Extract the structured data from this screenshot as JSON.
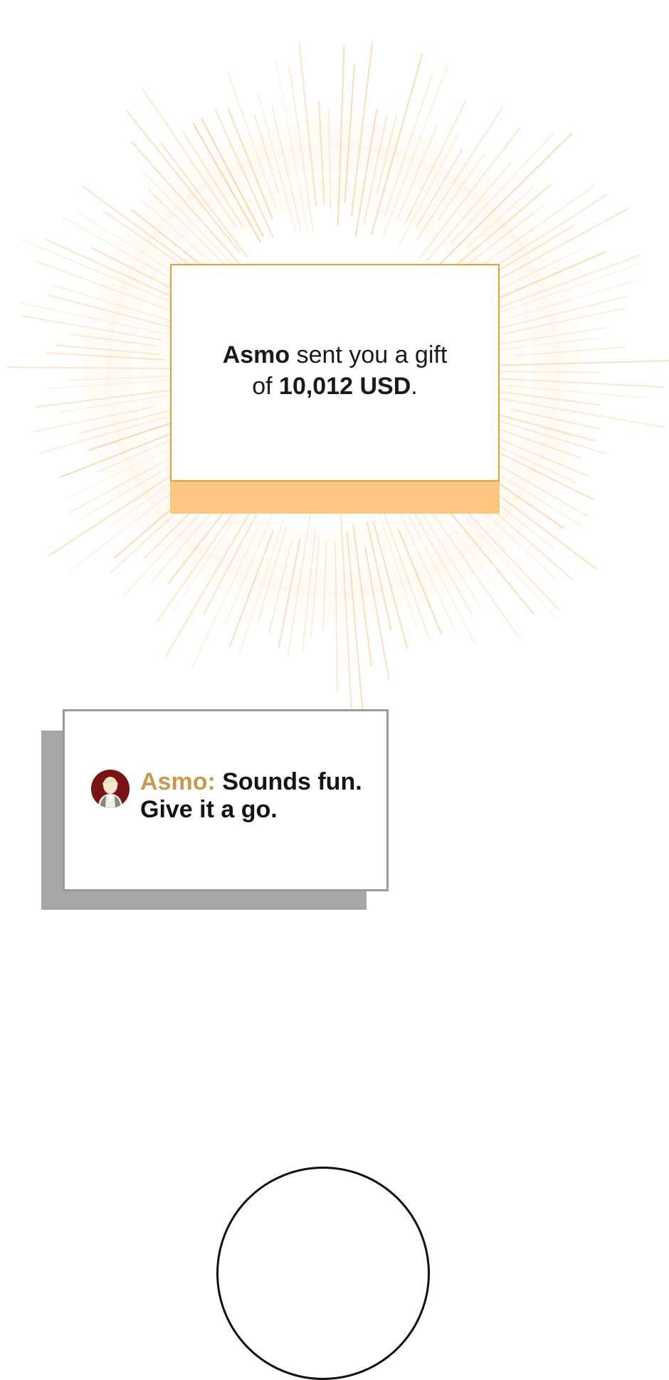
{
  "colors": {
    "gift_border": "#f29a33",
    "gift_tab": "#fcc580",
    "burst_ray": "#f6c27a",
    "speaker_name": "#c79a4e",
    "chat_border": "#9b9b9b",
    "chat_shadow": "#a6a6a6",
    "avatar_bg": "#7a1414"
  },
  "gift_notification": {
    "sender": "Asmo",
    "line1_rest": " sent you a gift",
    "line2_prefix": "of ",
    "amount": "10,012 USD",
    "line2_suffix": "."
  },
  "chat_message": {
    "avatar_icon": "character-avatar-icon",
    "speaker": "Asmo:",
    "line1": " Sounds fun.",
    "line2": "Give it a go."
  },
  "decoration": {
    "burst_icon": "radial-light-burst",
    "bottom_shape": "circle-outline"
  }
}
